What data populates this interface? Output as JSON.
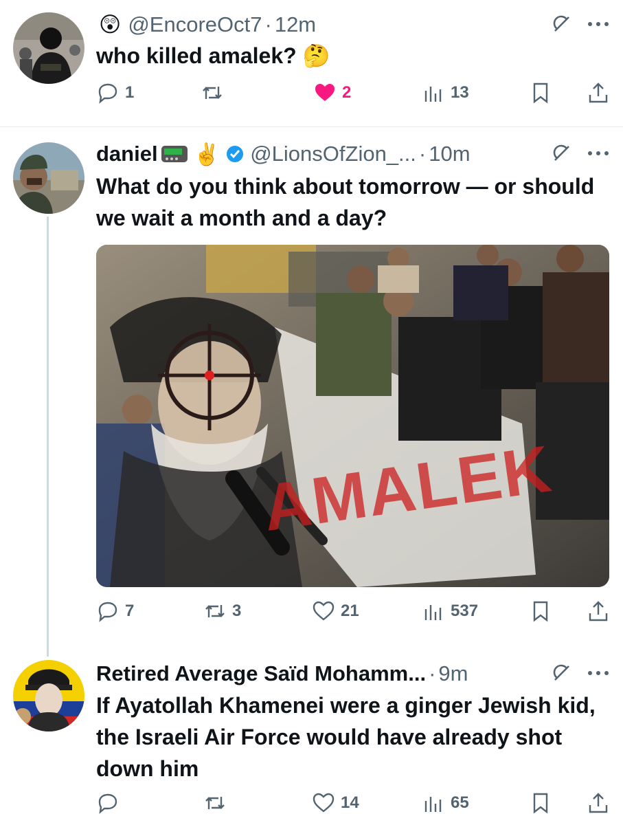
{
  "posts": [
    {
      "emoji": "😲",
      "name": "",
      "handle": "@EncoreOct7",
      "separator": "·",
      "time": "12m",
      "text": "who killed amalek? 🤔",
      "replies": "1",
      "reposts": "",
      "likes": "2",
      "views": "13"
    },
    {
      "name": "daniel",
      "badge_emoji": "📟",
      "peace_emoji": "✌️",
      "verified": true,
      "handle": "@LionsOfZion_...",
      "separator": "·",
      "time": "10m",
      "text": "What do you think about tomorrow — or should we wait a month and a day?",
      "media": {
        "overlay_text": "AMALEK"
      },
      "replies": "7",
      "reposts": "3",
      "likes": "21",
      "views": "537"
    },
    {
      "name": "Retired Average Saïd Mohamm...",
      "separator": "·",
      "time": "9m",
      "text": "If Ayatollah Khamenei were a ginger Jewish kid, the Israeli Air Force would have already shot down him",
      "replies": "",
      "reposts": "",
      "likes": "14",
      "views": "65"
    }
  ],
  "icons": {
    "reply": "reply-icon",
    "repost": "repost-icon",
    "like": "heart-icon",
    "views": "views-icon",
    "bookmark": "bookmark-icon",
    "share": "share-icon",
    "grok": "grok-icon",
    "more": "more-icon"
  },
  "colors": {
    "muted": "#536471",
    "like_active": "#f91880",
    "verified": "#1d9bf0",
    "text": "#0f1419"
  }
}
